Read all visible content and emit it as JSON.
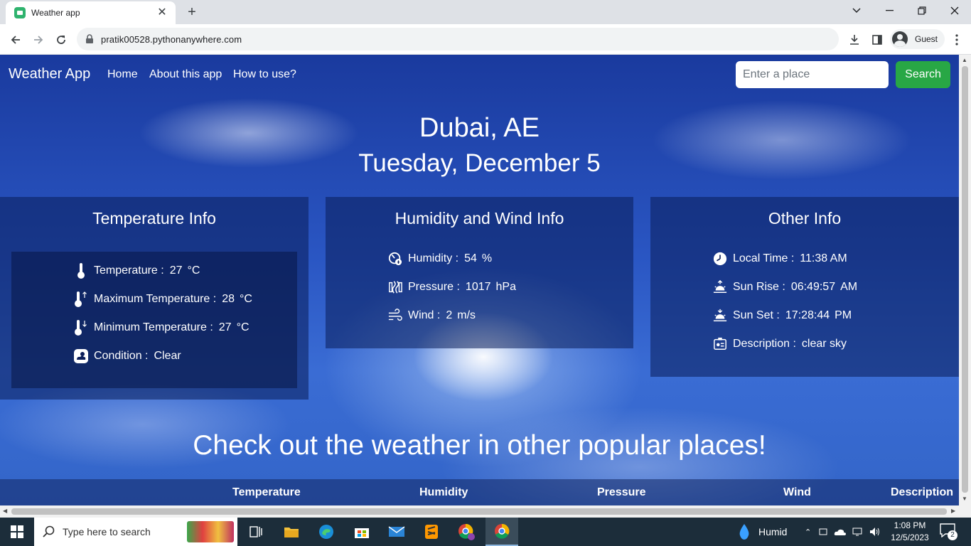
{
  "browser": {
    "tab_title": "Weather app",
    "url": "pratik00528.pythonanywhere.com",
    "profile": "Guest"
  },
  "nav": {
    "brand": "Weather App",
    "links": [
      "Home",
      "About this app",
      "How to use?"
    ],
    "search_placeholder": "Enter a place",
    "search_button": "Search"
  },
  "header": {
    "city": "Dubai, AE",
    "date": "Tuesday, December 5"
  },
  "temperature_card": {
    "title": "Temperature Info",
    "rows": [
      {
        "label": "Temperature :",
        "value": "27",
        "unit": "°C",
        "icon": "thermometer-icon"
      },
      {
        "label": "Maximum Temperature :",
        "value": "28",
        "unit": "°C",
        "icon": "thermometer-up-icon"
      },
      {
        "label": "Minimum Temperature :",
        "value": "27",
        "unit": "°C",
        "icon": "thermometer-down-icon"
      },
      {
        "label": "Condition :",
        "value": "Clear",
        "unit": "",
        "icon": "cloud-sun-icon"
      }
    ]
  },
  "humidity_card": {
    "title": "Humidity and Wind Info",
    "rows": [
      {
        "label": "Humidity :",
        "value": "54",
        "unit": "%",
        "icon": "gauge-icon"
      },
      {
        "label": "Pressure :",
        "value": "1017",
        "unit": "hPa",
        "icon": "pressure-icon"
      },
      {
        "label": "Wind :",
        "value": "2",
        "unit": "m/s",
        "icon": "wind-icon"
      }
    ]
  },
  "other_card": {
    "title": "Other Info",
    "rows": [
      {
        "label": "Local Time :",
        "value": "11:38 AM",
        "unit": "",
        "icon": "clock-icon"
      },
      {
        "label": "Sun Rise :",
        "value": "06:49:57",
        "unit": "AM",
        "icon": "sunrise-icon"
      },
      {
        "label": "Sun Set :",
        "value": "17:28:44",
        "unit": "PM",
        "icon": "sunset-icon"
      },
      {
        "label": "Description :",
        "value": "clear sky",
        "unit": "",
        "icon": "description-icon"
      }
    ]
  },
  "popular": {
    "title": "Check out the weather in other popular places!",
    "columns": [
      "Temperature",
      "Humidity",
      "Pressure",
      "Wind",
      "Description"
    ]
  },
  "taskbar": {
    "search_placeholder": "Type here to search",
    "weather": "Humid",
    "time": "1:08 PM",
    "date": "12/5/2023",
    "notifications": "2"
  },
  "colors": {
    "search_button": "#28a745",
    "sky": "#2a56c3"
  }
}
